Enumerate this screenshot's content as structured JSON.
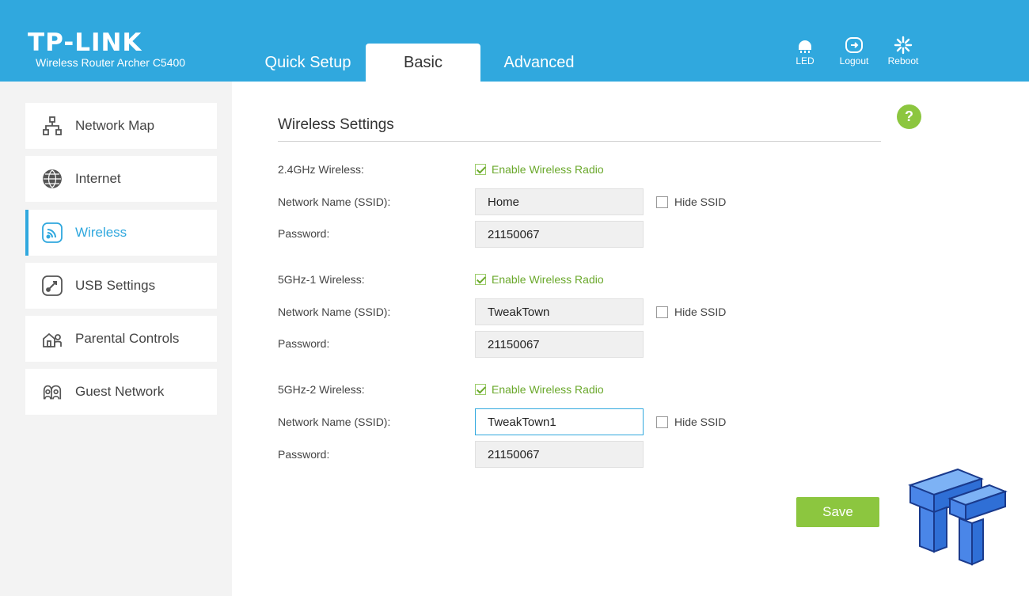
{
  "header": {
    "brand": "TP-LINK",
    "model": "Wireless Router Archer C5400",
    "tabs": [
      {
        "label": "Quick Setup",
        "active": false
      },
      {
        "label": "Basic",
        "active": true
      },
      {
        "label": "Advanced",
        "active": false
      }
    ],
    "buttons": [
      {
        "label": "LED",
        "icon": "led-icon"
      },
      {
        "label": "Logout",
        "icon": "logout-icon"
      },
      {
        "label": "Reboot",
        "icon": "reboot-icon"
      }
    ],
    "color": "#30a8de"
  },
  "sidebar": {
    "items": [
      {
        "label": "Network Map",
        "icon": "network-map-icon",
        "active": false
      },
      {
        "label": "Internet",
        "icon": "globe-icon",
        "active": false
      },
      {
        "label": "Wireless",
        "icon": "wifi-icon",
        "active": true
      },
      {
        "label": "USB Settings",
        "icon": "usb-icon",
        "active": false
      },
      {
        "label": "Parental Controls",
        "icon": "parental-controls-icon",
        "active": false
      },
      {
        "label": "Guest Network",
        "icon": "guest-network-icon",
        "active": false
      }
    ]
  },
  "main": {
    "title": "Wireless Settings",
    "help_label": "?",
    "bands": [
      {
        "band_label": "2.4GHz Wireless:",
        "enable_label": "Enable Wireless Radio",
        "enabled": true,
        "ssid_label": "Network Name (SSID):",
        "ssid_value": "Home",
        "hide_ssid_label": "Hide SSID",
        "hide_ssid": false,
        "password_label": "Password:",
        "password_value": "21150067"
      },
      {
        "band_label": "5GHz-1 Wireless:",
        "enable_label": "Enable Wireless Radio",
        "enabled": true,
        "ssid_label": "Network Name (SSID):",
        "ssid_value": "TweakTown",
        "hide_ssid_label": "Hide SSID",
        "hide_ssid": false,
        "password_label": "Password:",
        "password_value": "21150067"
      },
      {
        "band_label": "5GHz-2 Wireless:",
        "enable_label": "Enable Wireless Radio",
        "enabled": true,
        "ssid_label": "Network Name (SSID):",
        "ssid_value": "TweakTown1",
        "hide_ssid_label": "Hide SSID",
        "hide_ssid": false,
        "password_label": "Password:",
        "password_value": "21150067"
      }
    ],
    "save_label": "Save",
    "accent_color": "#8cc63f"
  }
}
